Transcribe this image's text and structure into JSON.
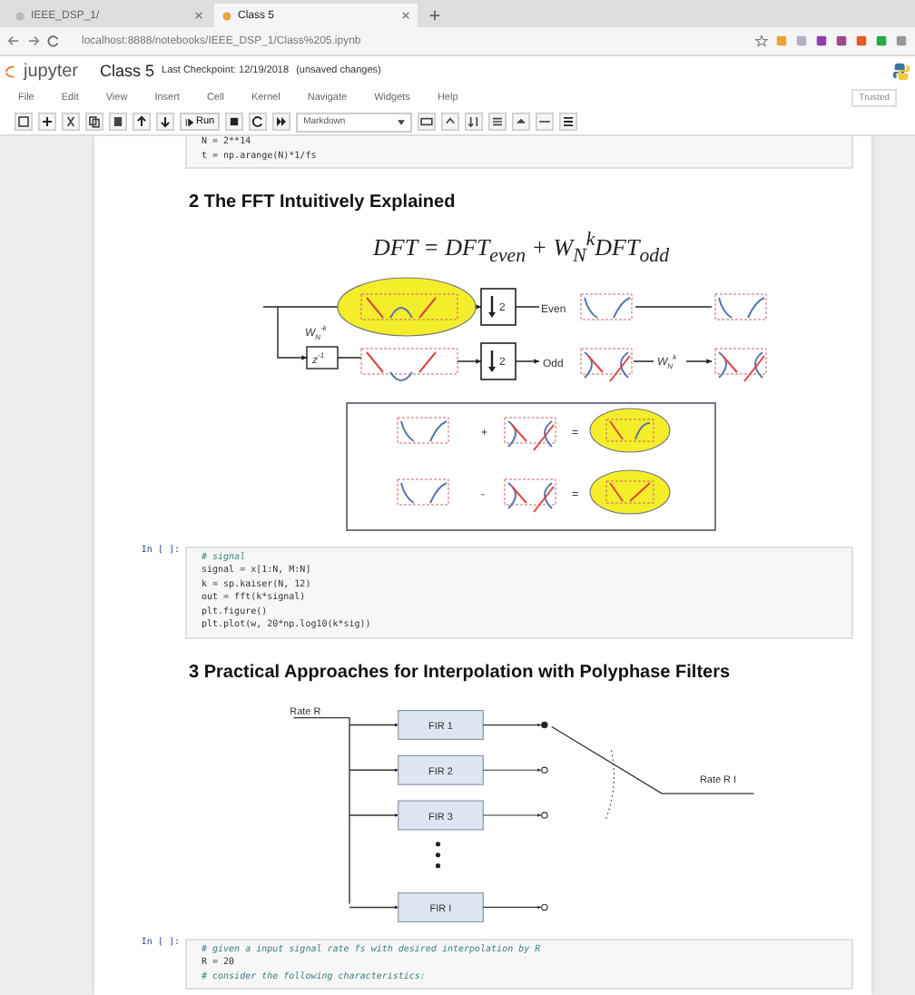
{
  "browser": {
    "tabs": [
      {
        "title": "IEEE_DSP_1/",
        "selected": false
      },
      {
        "title": "Class 5",
        "selected": true
      }
    ],
    "url": "localhost:8888/notebooks/IEEE_DSP_1/Class%205.ipynb"
  },
  "header": {
    "logo": "jupyter",
    "title": "Class 5",
    "checkpoint": "Last Checkpoint: 12/19/2018",
    "status": "(unsaved changes)",
    "trusted": "Trusted"
  },
  "menu": [
    "File",
    "Edit",
    "View",
    "Insert",
    "Cell",
    "Kernel",
    "Navigate",
    "Widgets",
    "Help"
  ],
  "toolbar": {
    "run_label": "Run",
    "cell_type": "Markdown"
  },
  "cells": [
    {
      "kind": "code",
      "lines": [
        {
          "kind": "code",
          "text": "N = 2**14"
        },
        {
          "kind": "code",
          "text": "t = np.arange(N)*1/fs"
        }
      ]
    },
    {
      "kind": "heading",
      "text": "2  The FFT Intuitively Explained"
    },
    {
      "kind": "fft_figure",
      "equation": "DFT = DFT$_{even}$ + W$_{N}$$^{k}$DFT$_{odd}$",
      "twiddle_neg": "W$_{N}$$^{-k}$",
      "delay": "z$^{-1}$",
      "down": [
        "2",
        "2"
      ],
      "even": "Even",
      "odd": "Odd",
      "twiddle": "W$_{N}$$^{k}$",
      "ops": [
        "+",
        "=",
        "-",
        "="
      ]
    },
    {
      "kind": "code",
      "prompt": "In [ ]:",
      "lines": [
        {
          "kind": "comment",
          "text": "# signal"
        },
        {
          "kind": "code",
          "text": "signal = x[1:N, M:N]"
        },
        {
          "kind": "code",
          "text": "k = sp.kaiser(N, 12)"
        },
        {
          "kind": "code",
          "text": "out = fft(k*signal)"
        },
        {
          "kind": "code",
          "text": "plt.figure()"
        },
        {
          "kind": "code",
          "text": "plt.plot(w, 20*np.log10(k*sig))"
        }
      ]
    },
    {
      "kind": "heading",
      "text": "3  Practical Approaches for Interpolation with Polyphase Filters"
    },
    {
      "kind": "polyphase_figure",
      "input": "Rate R",
      "output": "Rate R I",
      "filters": [
        {
          "label": "FIR 1",
          "selected": true
        },
        {
          "label": "FIR 2",
          "selected": false
        },
        {
          "label": "FIR 3",
          "selected": false
        },
        {
          "label": "FIR I",
          "selected": false
        }
      ]
    },
    {
      "kind": "code",
      "prompt": "In [ ]:",
      "lines": [
        {
          "kind": "comment",
          "text": "# given a input signal rate fs with desired interpolation by R"
        },
        {
          "kind": "code",
          "text": "R = 20"
        },
        {
          "kind": "comment",
          "text": "# consider the following characteristics:"
        }
      ]
    }
  ]
}
